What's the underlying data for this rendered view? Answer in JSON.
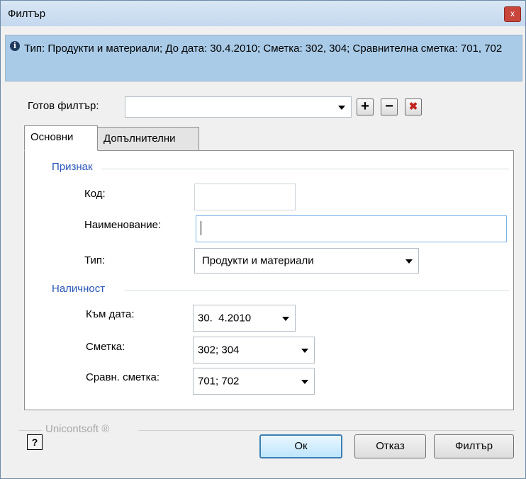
{
  "window": {
    "title": "Филтър",
    "close_label": "x"
  },
  "info": {
    "text": "Тип: Продукти и материали; До дата: 30.4.2010; Сметка: 302, 304; Сравнителна сметка: 701, 702",
    "icon": "info-icon"
  },
  "preset": {
    "label": "Готов филтър:",
    "value": "",
    "add_icon": "+",
    "remove_icon": "−",
    "clear_icon": "✖"
  },
  "tabs": [
    {
      "label": "Основни",
      "active": true
    },
    {
      "label": "Допълнителни",
      "active": false
    }
  ],
  "groups": {
    "attribute": {
      "title": "Признак",
      "code_label": "Код:",
      "code_value": "",
      "name_label": "Наименование:",
      "name_value": "",
      "type_label": "Тип:",
      "type_value": "Продукти и материали"
    },
    "availability": {
      "title": "Наличност",
      "date_label": "Към дата:",
      "date_value": "30.  4.2010",
      "account_label": "Сметка:",
      "account_value": "302; 304",
      "compare_label": "Сравн. сметка:",
      "compare_value": "701; 702"
    }
  },
  "footer": {
    "brand": "Unicontsoft ®",
    "help_icon": "?",
    "ok_label": "Ок",
    "cancel_label": "Отказ",
    "filter_label": "Филтър"
  },
  "colors": {
    "info_bg": "#a9cbe8",
    "group_title": "#2a57b8",
    "default_button_border": "#3c7fb1"
  }
}
